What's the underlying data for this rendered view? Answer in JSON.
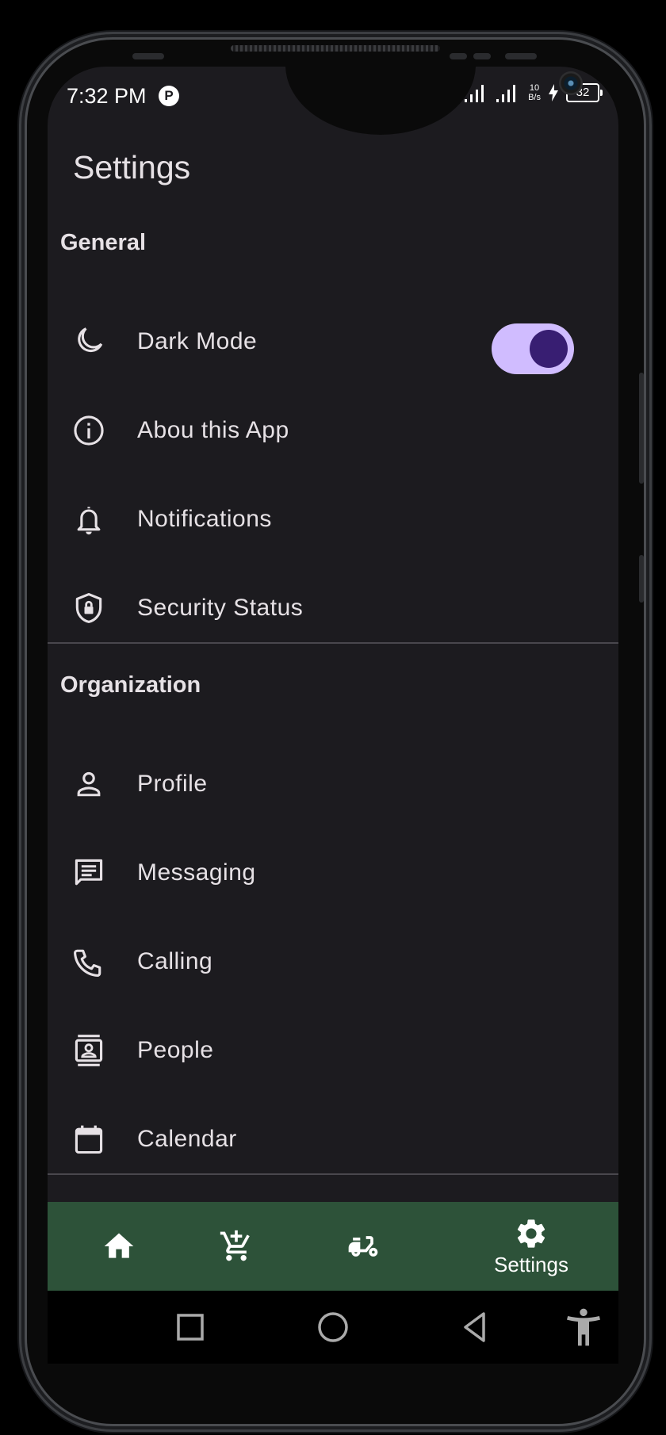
{
  "status_bar": {
    "time": "7:32 PM",
    "app_icon": "P",
    "net_speed_value": "10",
    "net_speed_unit": "B/s",
    "battery": "32"
  },
  "page": {
    "title": "Settings"
  },
  "sections": {
    "general": {
      "header": "General",
      "items": [
        {
          "label": "Dark Mode",
          "icon": "moon-icon",
          "toggle_on": true
        },
        {
          "label": "Abou this App",
          "icon": "info-icon"
        },
        {
          "label": "Notifications",
          "icon": "bell-icon"
        },
        {
          "label": "Security Status",
          "icon": "shield-lock-icon"
        }
      ]
    },
    "organization": {
      "header": "Organization",
      "items": [
        {
          "label": "Profile",
          "icon": "person-icon"
        },
        {
          "label": "Messaging",
          "icon": "message-icon"
        },
        {
          "label": "Calling",
          "icon": "phone-icon"
        },
        {
          "label": "People",
          "icon": "contacts-icon"
        },
        {
          "label": "Calendar",
          "icon": "calendar-icon"
        }
      ]
    }
  },
  "bottom_nav": {
    "items": [
      {
        "icon": "home-icon"
      },
      {
        "icon": "add-cart-icon"
      },
      {
        "icon": "scooter-icon"
      },
      {
        "icon": "gear-icon",
        "label": "Settings",
        "selected": true
      }
    ]
  },
  "system_nav": {
    "items": [
      "recents-icon",
      "home-circle-icon",
      "back-icon",
      "accessibility-icon"
    ]
  },
  "colors": {
    "background": "#1c1b1f",
    "text": "#e6e1e5",
    "toggle_track": "#d0bcff",
    "toggle_thumb": "#381e72",
    "bottom_nav": "#2d5239"
  }
}
